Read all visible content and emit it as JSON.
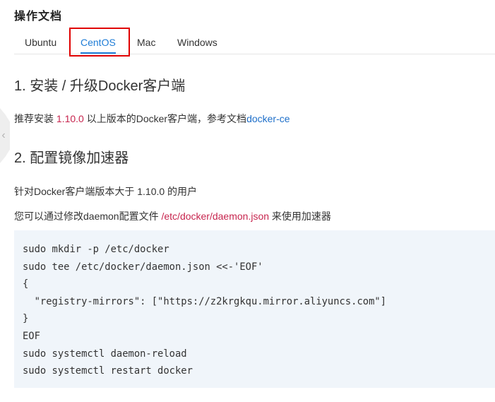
{
  "page_title": "操作文档",
  "tabs": [
    {
      "label": "Ubuntu",
      "active": false
    },
    {
      "label": "CentOS",
      "active": true
    },
    {
      "label": "Mac",
      "active": false
    },
    {
      "label": "Windows",
      "active": false
    }
  ],
  "colors": {
    "accent": "#1e7cd6",
    "highlight_border": "#e00000",
    "code_background": "#f0f5fa",
    "inline_highlight": "#c7254e"
  },
  "side_handle_icon": "chevron-left-icon",
  "section1": {
    "heading": "1. 安装 / 升级Docker客户端",
    "text_before": "推荐安装 ",
    "version": "1.10.0",
    "text_after": " 以上版本的Docker客户端，参考文档",
    "link_label": "docker-ce"
  },
  "section2": {
    "heading": "2. 配置镜像加速器",
    "line1": "针对Docker客户端版本大于 1.10.0 的用户",
    "line2_before": "您可以通过修改daemon配置文件 ",
    "line2_path": "/etc/docker/daemon.json",
    "line2_after": " 来使用加速器",
    "code_lines": [
      "sudo mkdir -p /etc/docker",
      "sudo tee /etc/docker/daemon.json <<-'EOF'",
      "{",
      "  \"registry-mirrors\": [\"https://z2krgkqu.mirror.aliyuncs.com\"]",
      "}",
      "EOF",
      "sudo systemctl daemon-reload",
      "sudo systemctl restart docker"
    ]
  }
}
